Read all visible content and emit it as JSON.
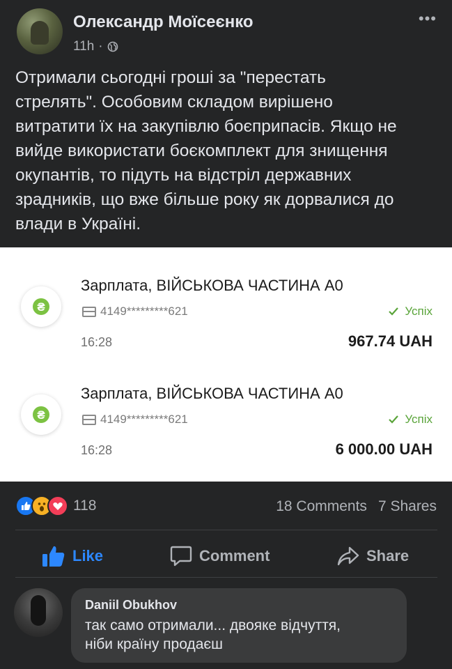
{
  "post": {
    "author": "Олександр Моїсеєнко",
    "time": "11h",
    "separator": "·",
    "more": "•••",
    "text": "Отримали сьогодні гроші за \"перестать\nстрелять\". Особовим складом вирішено\nвитратити їх на закупівлю боєприпасів. Якщо не\nвийде використати боєкомплект для знищення\nокупантів, то підуть на відстріл державних\nзрадників, що вже більше року як дорвалися до\nвлади в Україні."
  },
  "transactions": [
    {
      "title": "Зарплата, ВІЙСЬКОВА ЧАСТИНА А0",
      "card": "4149*********621",
      "status": "Успіх",
      "time": "16:28",
      "amount": "967.74 UAH",
      "icon_letter": "₴"
    },
    {
      "title": "Зарплата, ВІЙСЬКОВА ЧАСТИНА А0",
      "card": "4149*********621",
      "status": "Успіх",
      "time": "16:28",
      "amount": "6 000.00 UAH",
      "icon_letter": "₴"
    }
  ],
  "stats": {
    "reactions_count": "118",
    "comments": "18 Comments",
    "shares": "7 Shares"
  },
  "actions": {
    "like": "Like",
    "comment": "Comment",
    "share": "Share"
  },
  "comment": {
    "author": "Daniil Obukhov",
    "text": "так само отримали... двояке відчуття,\nніби країну продаєш"
  },
  "colors": {
    "background": "#242526",
    "accent": "#2d88ff",
    "success": "#5aa43a",
    "hryvnia_icon": "#7cc242"
  }
}
